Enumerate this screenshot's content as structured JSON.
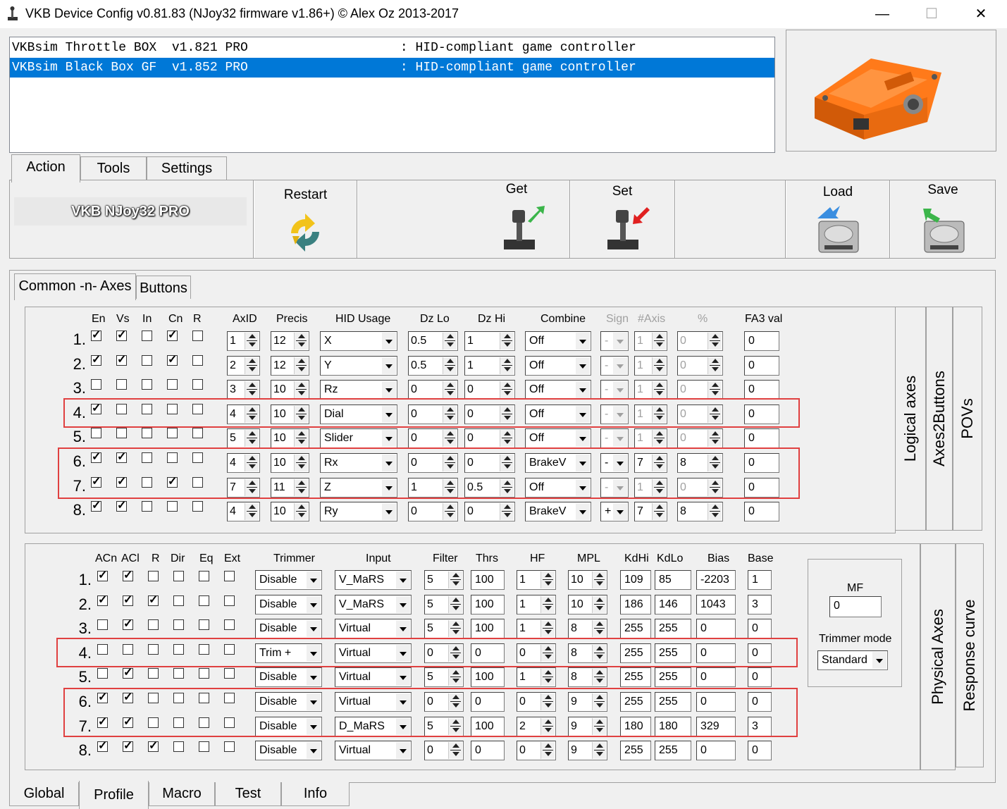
{
  "window": {
    "title": "VKB Device Config v0.81.83  (NJoy32 firmware v1.86+) © Alex Oz 2013-2017",
    "min": "—",
    "max": "☐",
    "close": "✕"
  },
  "devices": [
    {
      "text": "VKBsim Throttle BOX  v1.821 PRO                    : HID-compliant game controller",
      "selected": false
    },
    {
      "text": "VKBsim Black Box GF  v1.852 PRO                    : HID-compliant game controller",
      "selected": true
    }
  ],
  "main_tabs": [
    "Action",
    "Tools",
    "Settings"
  ],
  "toolbar": {
    "brand": "VKB NJoy32 PRO",
    "restart": "Restart",
    "get": "Get",
    "set": "Set",
    "load": "Load",
    "save": "Save"
  },
  "sub_tabs": [
    "Common -n- Axes",
    "Buttons"
  ],
  "side_tabs_top": [
    "Logical axes",
    "Axes2Buttons",
    "POVs"
  ],
  "side_tabs_bottom": [
    "Physical Axes",
    "Response curve"
  ],
  "logical": {
    "headers": [
      "En",
      "Vs",
      "In",
      "Cn",
      "R",
      "AxID",
      "Precis",
      "HID Usage",
      "Dz Lo",
      "Dz Hi",
      "Combine",
      "Sign",
      "#Axis",
      "%",
      "FA3 val"
    ],
    "rows": [
      {
        "n": "1.",
        "cb": [
          1,
          1,
          0,
          1,
          0
        ],
        "axid": "1",
        "precis": "12",
        "hid": "X",
        "dzlo": "0.5",
        "dzhi": "1",
        "combine": "Off",
        "sign": "-",
        "axis": "1",
        "pct": "0",
        "fa3": "0",
        "en": false
      },
      {
        "n": "2.",
        "cb": [
          1,
          1,
          0,
          1,
          0
        ],
        "axid": "2",
        "precis": "12",
        "hid": "Y",
        "dzlo": "0.5",
        "dzhi": "1",
        "combine": "Off",
        "sign": "-",
        "axis": "1",
        "pct": "0",
        "fa3": "0",
        "en": false
      },
      {
        "n": "3.",
        "cb": [
          0,
          0,
          0,
          0,
          0
        ],
        "axid": "3",
        "precis": "10",
        "hid": "Rz",
        "dzlo": "0",
        "dzhi": "0",
        "combine": "Off",
        "sign": "-",
        "axis": "1",
        "pct": "0",
        "fa3": "0",
        "en": false
      },
      {
        "n": "4.",
        "cb": [
          1,
          0,
          0,
          0,
          0
        ],
        "axid": "4",
        "precis": "10",
        "hid": "Dial",
        "dzlo": "0",
        "dzhi": "0",
        "combine": "Off",
        "sign": "-",
        "axis": "1",
        "pct": "0",
        "fa3": "0",
        "en": false
      },
      {
        "n": "5.",
        "cb": [
          0,
          0,
          0,
          0,
          0
        ],
        "axid": "5",
        "precis": "10",
        "hid": "Slider",
        "dzlo": "0",
        "dzhi": "0",
        "combine": "Off",
        "sign": "-",
        "axis": "1",
        "pct": "0",
        "fa3": "0",
        "en": false
      },
      {
        "n": "6.",
        "cb": [
          1,
          1,
          0,
          0,
          0
        ],
        "axid": "4",
        "precis": "10",
        "hid": "Rx",
        "dzlo": "0",
        "dzhi": "0",
        "combine": "BrakeV",
        "sign": "-",
        "axis": "7",
        "pct": "8",
        "fa3": "0",
        "en": true
      },
      {
        "n": "7.",
        "cb": [
          1,
          1,
          0,
          1,
          0
        ],
        "axid": "7",
        "precis": "11",
        "hid": "Z",
        "dzlo": "1",
        "dzhi": "0.5",
        "combine": "Off",
        "sign": "-",
        "axis": "1",
        "pct": "0",
        "fa3": "0",
        "en": false
      },
      {
        "n": "8.",
        "cb": [
          1,
          1,
          0,
          0,
          0
        ],
        "axid": "4",
        "precis": "10",
        "hid": "Ry",
        "dzlo": "0",
        "dzhi": "0",
        "combine": "BrakeV",
        "sign": "+",
        "axis": "7",
        "pct": "8",
        "fa3": "0",
        "en": true
      }
    ]
  },
  "physical": {
    "headers": [
      "ACn",
      "ACl",
      "R",
      "Dir",
      "Eq",
      "Ext",
      "Trimmer",
      "Input",
      "Filter",
      "Thrs",
      "HF",
      "MPL",
      "KdHi",
      "KdLo",
      "Bias",
      "Base"
    ],
    "rows": [
      {
        "n": "1.",
        "cb": [
          1,
          1,
          0,
          0,
          0,
          0
        ],
        "trim": "Disable",
        "input": "V_MaRS",
        "filter": "5",
        "thrs": "100",
        "hf": "1",
        "mpl": "10",
        "kdhi": "109",
        "kdlo": "85",
        "bias": "-2203",
        "base": "1"
      },
      {
        "n": "2.",
        "cb": [
          1,
          1,
          1,
          0,
          0,
          0
        ],
        "trim": "Disable",
        "input": "V_MaRS",
        "filter": "5",
        "thrs": "100",
        "hf": "1",
        "mpl": "10",
        "kdhi": "186",
        "kdlo": "146",
        "bias": "1043",
        "base": "3"
      },
      {
        "n": "3.",
        "cb": [
          0,
          1,
          0,
          0,
          0,
          0
        ],
        "trim": "Disable",
        "input": "Virtual",
        "filter": "5",
        "thrs": "100",
        "hf": "1",
        "mpl": "8",
        "kdhi": "255",
        "kdlo": "255",
        "bias": "0",
        "base": "0"
      },
      {
        "n": "4.",
        "cb": [
          0,
          0,
          0,
          0,
          0,
          0
        ],
        "trim": "Trim +",
        "input": "Virtual",
        "filter": "0",
        "thrs": "0",
        "hf": "0",
        "mpl": "8",
        "kdhi": "255",
        "kdlo": "255",
        "bias": "0",
        "base": "0"
      },
      {
        "n": "5.",
        "cb": [
          0,
          1,
          0,
          0,
          0,
          0
        ],
        "trim": "Disable",
        "input": "Virtual",
        "filter": "5",
        "thrs": "100",
        "hf": "1",
        "mpl": "8",
        "kdhi": "255",
        "kdlo": "255",
        "bias": "0",
        "base": "0"
      },
      {
        "n": "6.",
        "cb": [
          1,
          1,
          0,
          0,
          0,
          0
        ],
        "trim": "Disable",
        "input": "Virtual",
        "filter": "0",
        "thrs": "0",
        "hf": "0",
        "mpl": "9",
        "kdhi": "255",
        "kdlo": "255",
        "bias": "0",
        "base": "0"
      },
      {
        "n": "7.",
        "cb": [
          1,
          1,
          0,
          0,
          0,
          0
        ],
        "trim": "Disable",
        "input": "D_MaRS",
        "filter": "5",
        "thrs": "100",
        "hf": "2",
        "mpl": "9",
        "kdhi": "180",
        "kdlo": "180",
        "bias": "329",
        "base": "3"
      },
      {
        "n": "8.",
        "cb": [
          1,
          1,
          1,
          0,
          0,
          0
        ],
        "trim": "Disable",
        "input": "Virtual",
        "filter": "0",
        "thrs": "0",
        "hf": "0",
        "mpl": "9",
        "kdhi": "255",
        "kdlo": "255",
        "bias": "0",
        "base": "0"
      }
    ]
  },
  "mf": {
    "label": "MF",
    "value": "0",
    "trimmer_mode_label": "Trimmer mode",
    "trimmer_mode": "Standard"
  },
  "bottom_tabs": [
    "Global",
    "Profile",
    "Macro",
    "Test",
    "Info"
  ],
  "colors": {
    "selection": "#0078d7",
    "highlight": "#e04040",
    "device": "#ff7a1a"
  }
}
